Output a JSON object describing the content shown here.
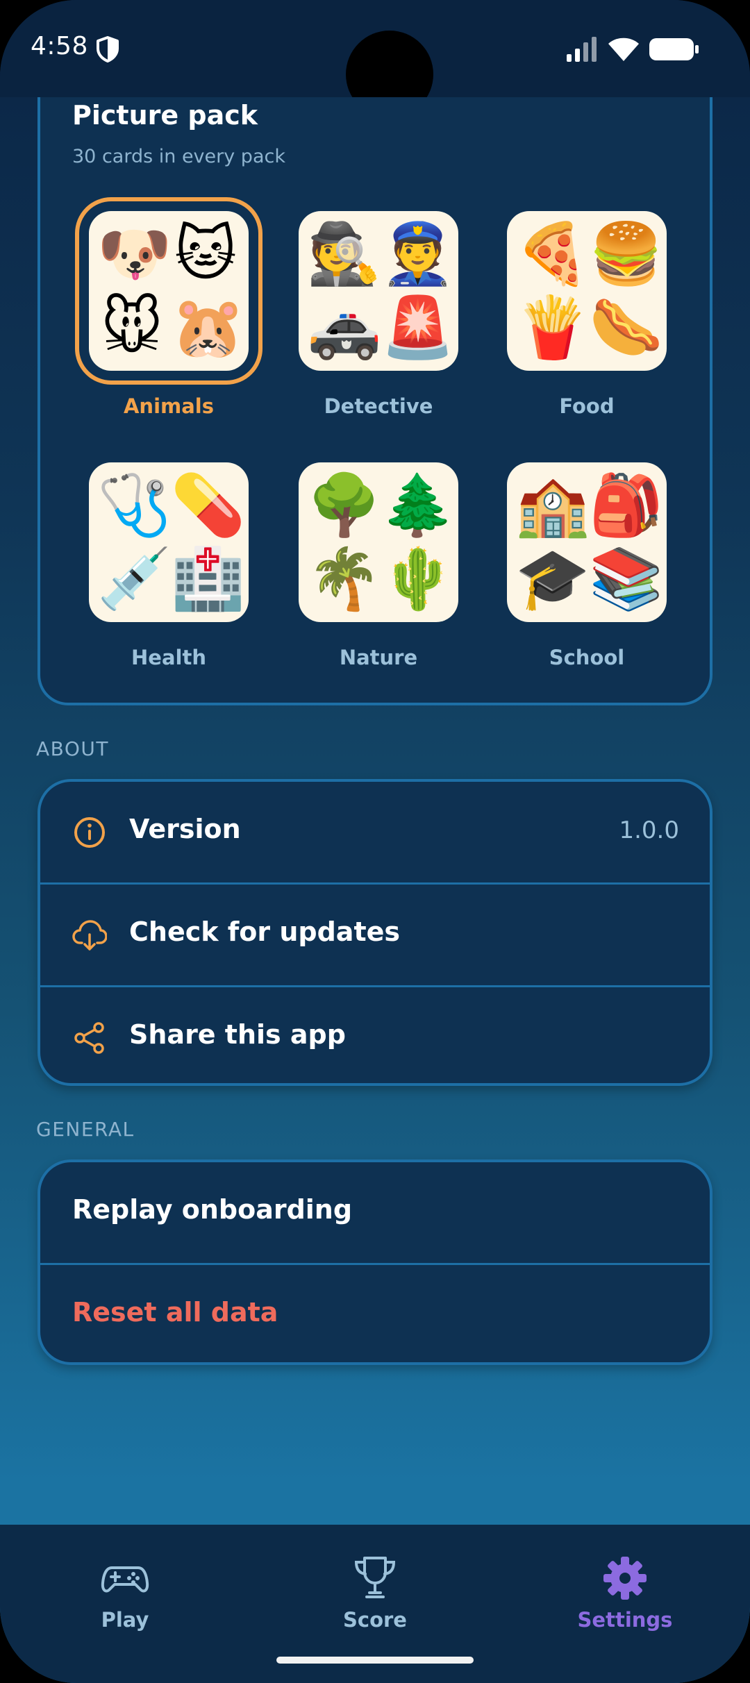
{
  "status_bar": {
    "time": "4:58"
  },
  "picture_pack": {
    "title": "Picture pack",
    "subtitle": "30 cards in every pack",
    "packs": [
      {
        "label": "Animals",
        "selected": true,
        "emojis": [
          "🐶",
          "🐱",
          "🐭",
          "🐹"
        ]
      },
      {
        "label": "Detective",
        "selected": false,
        "emojis": [
          "🕵️",
          "👮",
          "🚓",
          "🚨"
        ]
      },
      {
        "label": "Food",
        "selected": false,
        "emojis": [
          "🍕",
          "🍔",
          "🍟",
          "🌭"
        ]
      },
      {
        "label": "Health",
        "selected": false,
        "emojis": [
          "🩺",
          "💊",
          "💉",
          "🏥"
        ]
      },
      {
        "label": "Nature",
        "selected": false,
        "emojis": [
          "🌳",
          "🌲",
          "🌴",
          "🌵"
        ]
      },
      {
        "label": "School",
        "selected": false,
        "emojis": [
          "🏫",
          "🎒",
          "🎓",
          "📚"
        ]
      }
    ]
  },
  "about": {
    "header": "ABOUT",
    "version_label": "Version",
    "version_value": "1.0.0",
    "updates_label": "Check for updates",
    "share_label": "Share this app"
  },
  "general": {
    "header": "GENERAL",
    "replay_label": "Replay onboarding",
    "reset_label": "Reset all data"
  },
  "bottom_nav": {
    "items": [
      {
        "label": "Play",
        "icon": "gamepad-icon",
        "active": false
      },
      {
        "label": "Score",
        "icon": "trophy-icon",
        "active": false
      },
      {
        "label": "Settings",
        "icon": "gear-icon",
        "active": true
      }
    ]
  },
  "colors": {
    "accent_orange": "#f2a24a",
    "active_purple": "#8c6be0",
    "danger_red": "#ef6b5c"
  }
}
